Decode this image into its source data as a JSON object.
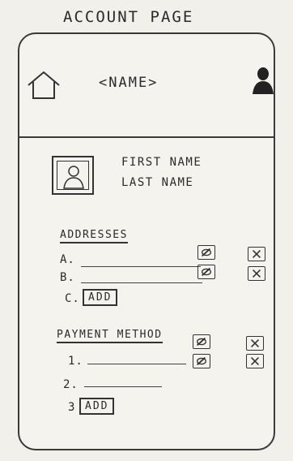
{
  "page": {
    "title": "ACCOUNT PAGE"
  },
  "topbar": {
    "name_title": "<NAME>",
    "icons": {
      "home": "home-icon",
      "account": "account-icon"
    }
  },
  "profile": {
    "avatar_icon": "avatar-icon",
    "first_name_label": "FIRST NAME",
    "last_name_label": "LAST NAME"
  },
  "addresses": {
    "heading": "ADDRESSES",
    "items": [
      {
        "label": "A.",
        "edit_icon": "edit-icon",
        "delete_icon": "delete-icon"
      },
      {
        "label": "B.",
        "edit_icon": "edit-icon",
        "delete_icon": "delete-icon"
      }
    ],
    "add_row_label": "C.",
    "add_label": "ADD"
  },
  "payment": {
    "heading": "PAYMENT METHOD",
    "items": [
      {
        "label": "1.",
        "edit_icon": "edit-icon",
        "delete_icon": "delete-icon"
      },
      {
        "label": "2."
      }
    ],
    "add_row_label": "3",
    "add_label": "ADD"
  }
}
